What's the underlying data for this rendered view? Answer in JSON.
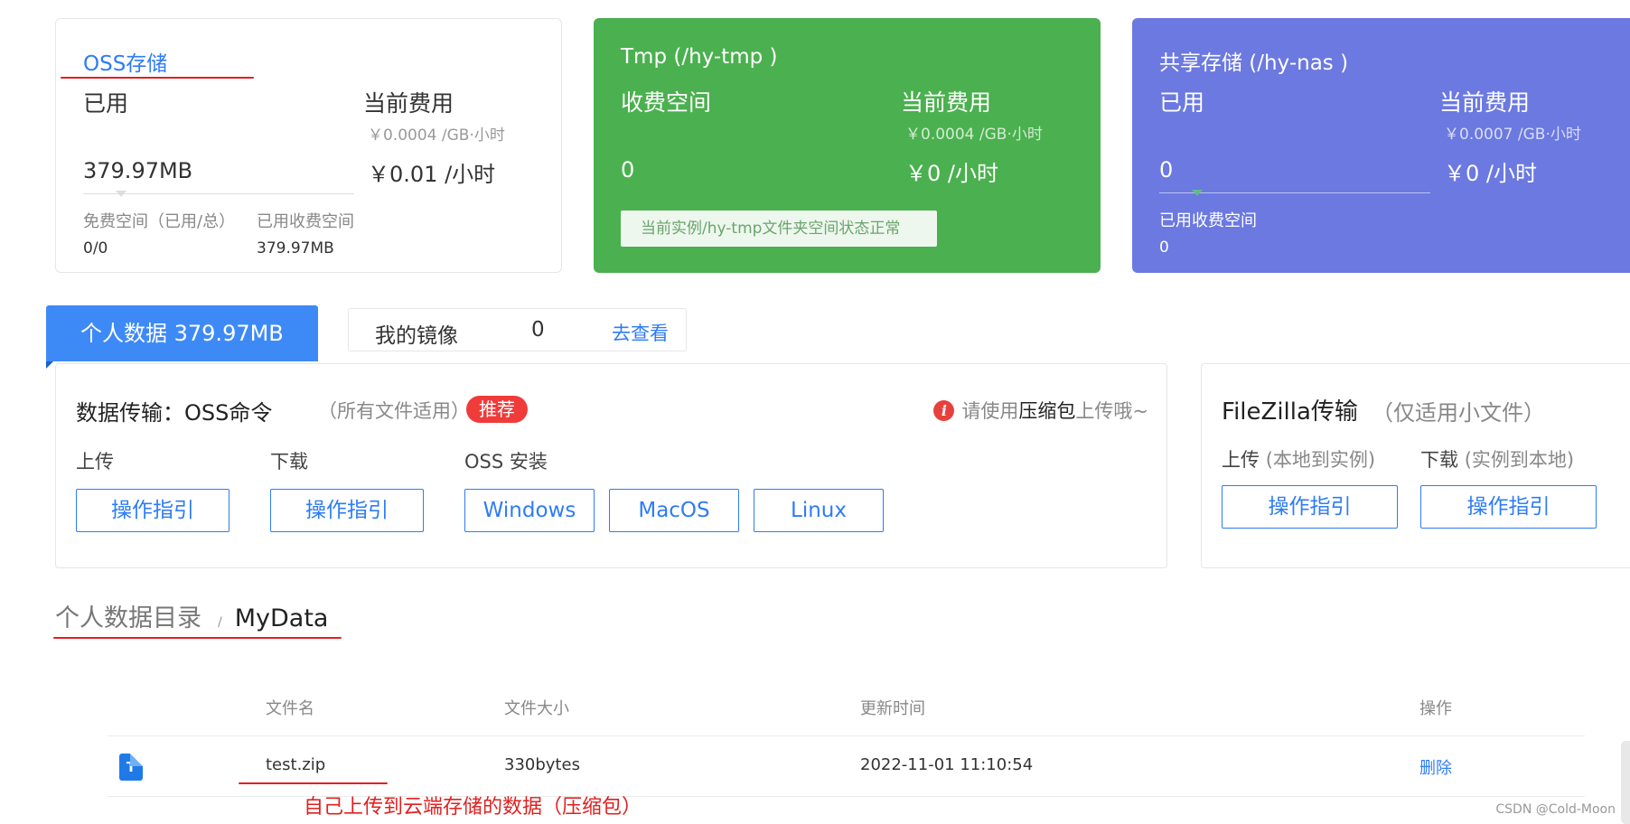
{
  "storage_cards": {
    "oss": {
      "title": "OSS存储",
      "used_label": "已用",
      "fee_label": "当前费用",
      "rate": "￥0.0004 /GB·小时",
      "used_value": "379.97MB",
      "fee_value": "￥0.01 /小时",
      "free_label": "免费空间（已用/总）",
      "free_value": "0/0",
      "paid_label": "已用收费空间",
      "paid_value": "379.97MB"
    },
    "tmp": {
      "title": "Tmp (/hy-tmp )",
      "used_label": "收费空间",
      "fee_label": "当前费用",
      "rate": "￥0.0004 /GB·小时",
      "used_value": "0",
      "fee_value": "￥0 /小时",
      "status": "当前实例/hy-tmp文件夹空间状态正常"
    },
    "nas": {
      "title": "共享存储 (/hy-nas )",
      "used_label": "已用",
      "fee_label": "当前费用",
      "rate": "￥0.0007 /GB·小时",
      "used_value": "0",
      "fee_value": "￥0 /小时",
      "paid_label": "已用收费空间",
      "paid_value": "0"
    }
  },
  "tabs": {
    "personal_data": "个人数据 379.97MB",
    "my_mirror_label": "我的镜像",
    "my_mirror_count": "0",
    "my_mirror_link": "去查看"
  },
  "oss_panel": {
    "title": "数据传输：OSS命令",
    "subtitle": "（所有文件适用）",
    "badge": "推荐",
    "notice_prefix": "请使用",
    "notice_emphasis": "压缩包",
    "notice_suffix": "上传哦~",
    "upload_label": "上传",
    "download_label": "下载",
    "install_label": "OSS 安装",
    "guide_button": "操作指引",
    "os_buttons": [
      "Windows",
      "MacOS",
      "Linux"
    ]
  },
  "filezilla_panel": {
    "title": "FileZilla传输",
    "subtitle": "（仅适用小文件）",
    "upload_label": "上传",
    "upload_hint": "(本地到实例)",
    "download_label": "下载",
    "download_hint": "(实例到本地)",
    "guide_button": "操作指引"
  },
  "breadcrumb": {
    "root": "个人数据目录",
    "separator": "/",
    "current": "MyData"
  },
  "table": {
    "headers": [
      "文件名",
      "文件大小",
      "更新时间",
      "操作"
    ],
    "rows": [
      {
        "icon_letter": "T",
        "name": "test.zip",
        "size": "330bytes",
        "updated": "2022-11-01 11:10:54",
        "action": "删除"
      }
    ]
  },
  "annotation": "自己上传到云端存储的数据（压缩包）",
  "watermark": "CSDN @Cold-Moon",
  "colors": {
    "primary": "#2e7cf6",
    "tmp_card": "#4bb04f",
    "nas_card": "#6b79e0",
    "badge_red": "#ef3b3a",
    "annotation_red": "#e02020"
  }
}
